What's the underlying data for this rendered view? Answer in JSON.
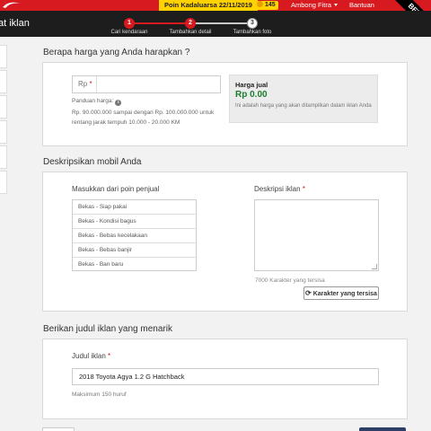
{
  "topbar": {
    "poin_text": "Poin Kadaluarsa 22/11/2019",
    "coin_count": "145",
    "user_name": "Ambong Fitra",
    "help_label": "Bantuan",
    "beta_label": "BETA"
  },
  "header": {
    "page_title": "at iklan",
    "steps": [
      {
        "number": "1",
        "label": "Cari kendaraan",
        "state": "done"
      },
      {
        "number": "2",
        "label": "Tambahkan detail",
        "state": "active"
      },
      {
        "number": "3",
        "label": "Tambahkan foto",
        "state": "todo"
      }
    ]
  },
  "price": {
    "section_title": "Berapa harga yang Anda harapkan ?",
    "prefix": "Rp",
    "required_mark": "*",
    "input_value": "",
    "guide_label": "Panduan harga:",
    "guide_text": "Rp. 90.000.000 sampai dengan Rp. 100.000.000 untuk rentang jarak tempuh 10.000 - 20.000 KM",
    "result_title": "Harga jual",
    "result_value": "Rp 0.00",
    "result_note": "Ini adalah harga yang akan ditampilkan dalam iklan Anda"
  },
  "description": {
    "section_title": "Deskripsikan mobil Anda",
    "points_label": "Masukkan dari poin penjual",
    "points": [
      "Bekas - Siap pakai",
      "Bekas - Kondisi bagus",
      "Bekas - Bebas kecelakaan",
      "Bekas - Bebas banjir",
      "Bekas - Ban baru"
    ],
    "desc_label": "Deskripsi iklan",
    "required_mark": "*",
    "textarea_value": "",
    "counter_text": "7000 Karakter yang tersisa",
    "chars_button": "Karakter yang tersisa"
  },
  "ad_title": {
    "section_title": "Berikan judul iklan yang menarik",
    "label": "Judul iklan",
    "required_mark": "*",
    "value": "2018 Toyota Agya 1.2 G Hatchback",
    "max_note": "Maksimum 150 huruf"
  },
  "colors": {
    "brand_red": "#d71920",
    "header_dark": "#1d1d1d",
    "highlight_yellow": "#ffd200",
    "price_green": "#1a7d2e"
  }
}
